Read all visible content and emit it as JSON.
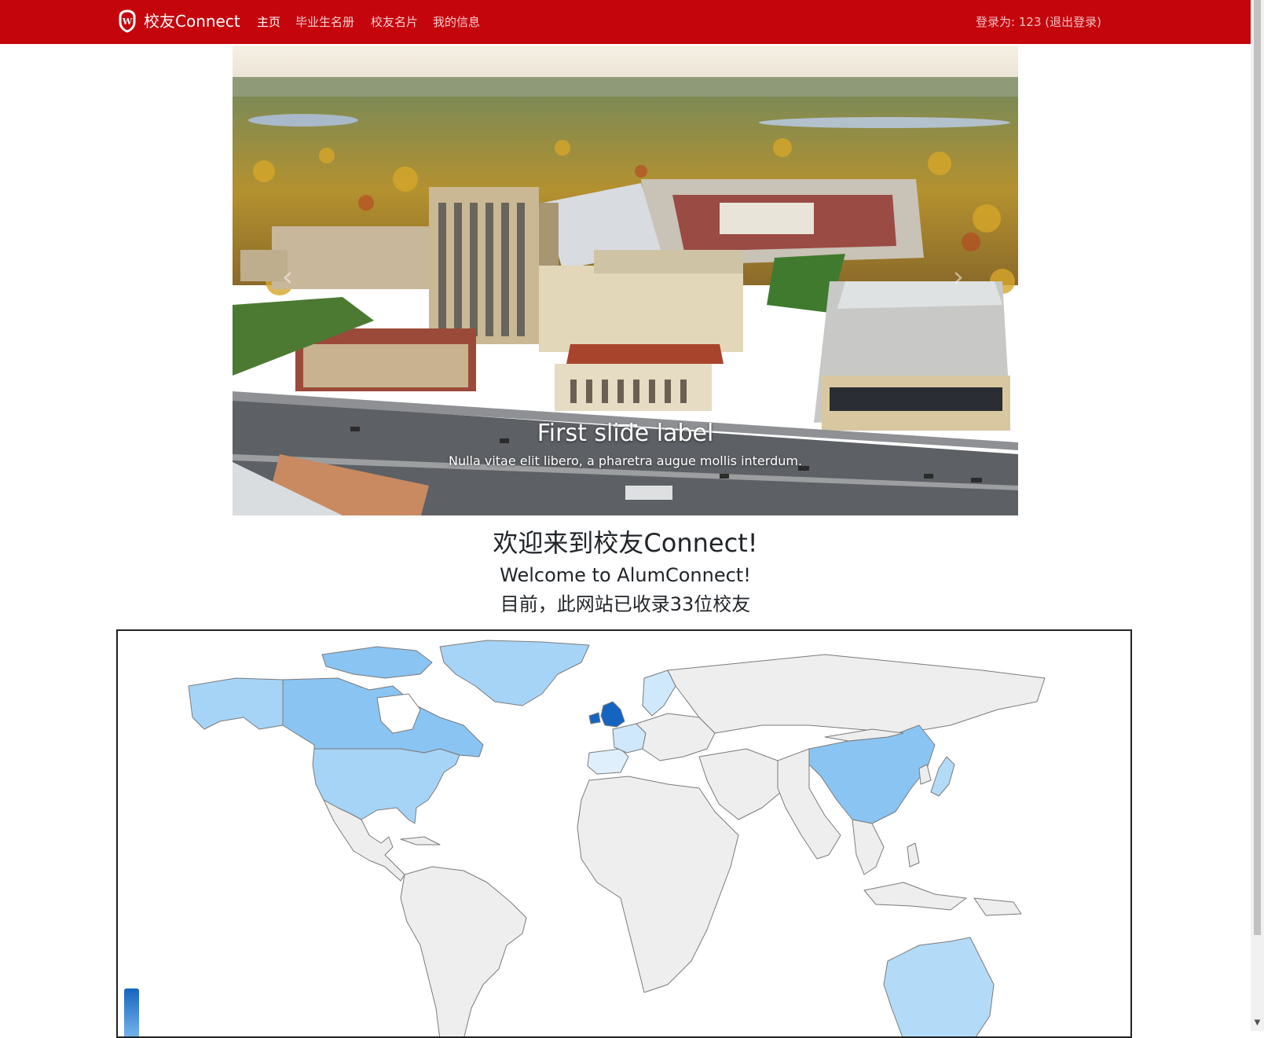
{
  "navbar": {
    "brand": "校友Connect",
    "links": [
      {
        "label": "主页",
        "active": true
      },
      {
        "label": "毕业生名册",
        "active": false
      },
      {
        "label": "校友名片",
        "active": false
      },
      {
        "label": "我的信息",
        "active": false
      }
    ],
    "login_prefix": "登录为: 123",
    "logout_label": "(退出登录)",
    "color": "#c5050c"
  },
  "carousel": {
    "slide_title": "First slide label",
    "slide_text": "Nulla vitae elit libero, a pharetra augue mollis interdum.",
    "prev_label": "‹",
    "next_label": "›"
  },
  "welcome": {
    "title_cn": "欢迎来到校友Connect!",
    "title_en": "Welcome to AlumConnect!",
    "count_text": "目前，此网站已收录33位校友"
  },
  "map": {
    "highlighted_countries": [
      {
        "name": "United Kingdom",
        "color": "#1565c0"
      },
      {
        "name": "Canada",
        "color": "#8ac4f2"
      },
      {
        "name": "China",
        "color": "#8ac4f2"
      },
      {
        "name": "United States",
        "color": "#a6d4f7"
      },
      {
        "name": "Australia",
        "color": "#b3dbf8"
      },
      {
        "name": "Greenland",
        "color": "#a6d4f7"
      },
      {
        "name": "Sweden",
        "color": "#cfe8fb"
      },
      {
        "name": "Japan",
        "color": "#b3dbf8"
      },
      {
        "name": "France",
        "color": "#cfe8fb"
      },
      {
        "name": "Spain",
        "color": "#dff0fc"
      }
    ],
    "default_color": "#eeeeee"
  }
}
